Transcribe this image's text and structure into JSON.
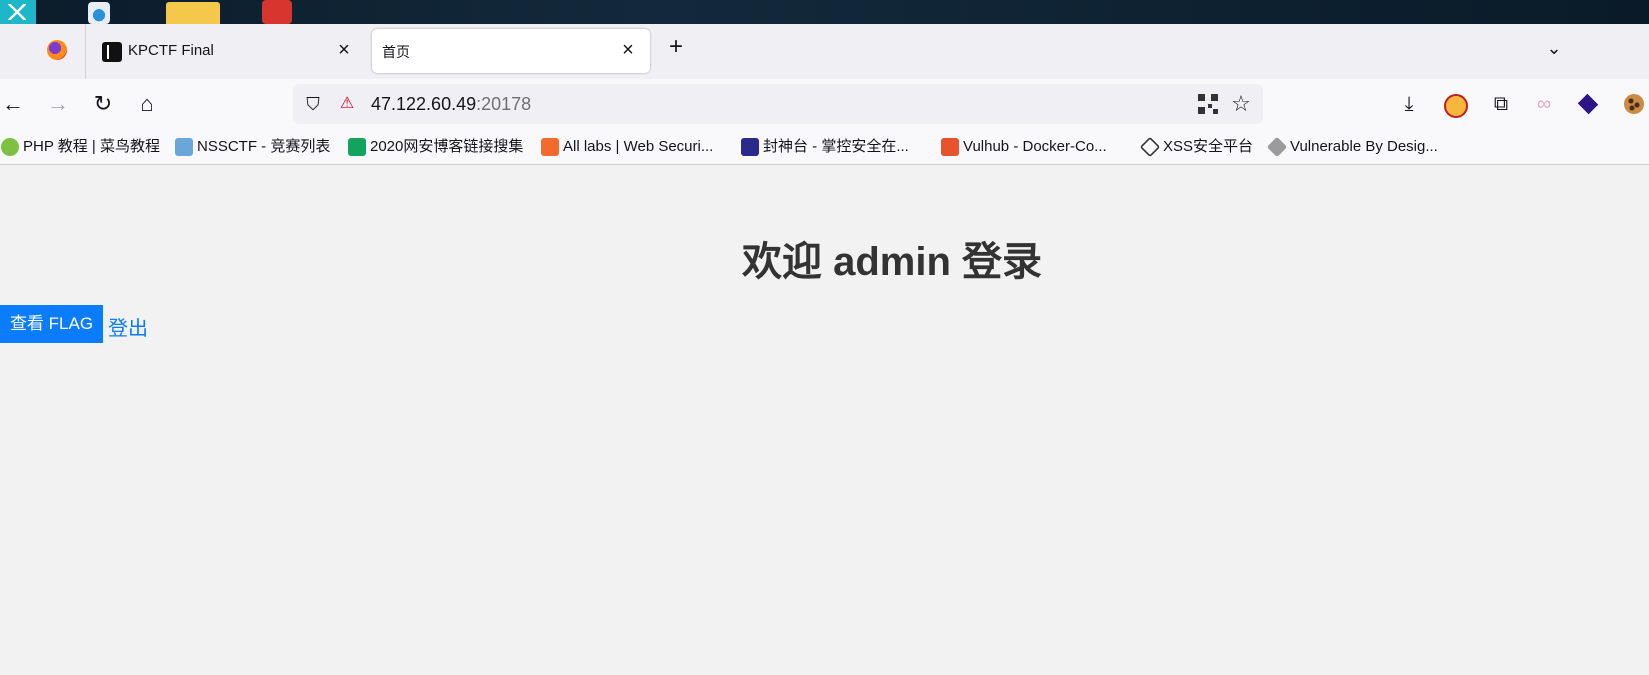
{
  "browser": {
    "tabs": [
      {
        "title": "KPCTF Final",
        "active": false
      },
      {
        "title": "首页",
        "active": true
      }
    ],
    "url": {
      "host": "47.122.60.49",
      "port": ":20178"
    },
    "bookmarks": [
      "PHP 教程 | 菜鸟教程",
      "NSSCTF - 竞赛列表",
      "2020网安博客链接搜集",
      "All labs | Web Securi...",
      "封神台 - 掌控安全在...",
      "Vulhub - Docker-Co...",
      "XSS安全平台",
      "Vulnerable By Desig..."
    ],
    "icons": {
      "close": "close-icon",
      "new_tab": "plus-icon",
      "tab_list": "chevron-down-icon",
      "back": "arrow-left-icon",
      "forward": "arrow-right-icon",
      "reload": "reload-icon",
      "home": "home-icon",
      "shield": "shield-icon",
      "insecure": "insecure-lock-icon",
      "qr": "qr-code-icon",
      "bookmark_star": "star-icon",
      "downloads": "download-icon",
      "extensions": "puzzle-icon"
    }
  },
  "page": {
    "heading": "欢迎 admin 登录",
    "flag_button": "查看 FLAG",
    "logout_link": "登出",
    "colors": {
      "accent": "#0a7cff",
      "background": "#f2f2f2",
      "heading": "#333333"
    }
  }
}
